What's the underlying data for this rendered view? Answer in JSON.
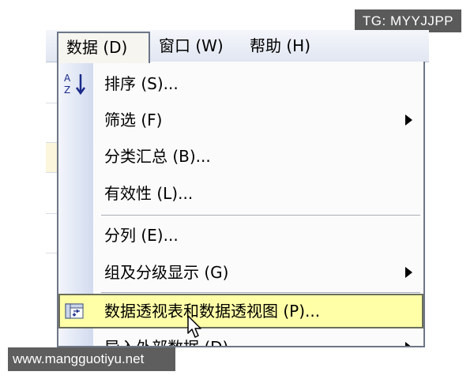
{
  "watermarks": {
    "top_right": "TG: MYYJJPP",
    "bottom_left": "www.mangguotiyu.net"
  },
  "menubar": {
    "items": [
      {
        "label": "数据 (D)",
        "active": true
      },
      {
        "label": "窗口 (W)",
        "active": false
      },
      {
        "label": "帮助 (H)",
        "active": false
      }
    ]
  },
  "dropdown": {
    "items": [
      {
        "label": "排序 (S)...",
        "icon": "sort-ascending-icon",
        "submenu": false
      },
      {
        "label": "筛选 (F)",
        "submenu": true
      },
      {
        "label": "分类汇总 (B)...",
        "submenu": false
      },
      {
        "label": "有效性 (L)...",
        "submenu": false
      },
      {
        "label": "分列 (E)...",
        "submenu": false
      },
      {
        "label": "组及分级显示 (G)",
        "submenu": true
      },
      {
        "label": "数据透视表和数据透视图 (P)...",
        "icon": "pivot-table-icon",
        "submenu": false,
        "highlighted": true
      },
      {
        "label": "导入外部数据 (D)",
        "submenu": true
      }
    ]
  },
  "colors": {
    "highlight": "#ffffa8",
    "menubar": "#e1e6f1",
    "gutter": "#d2dbef"
  }
}
